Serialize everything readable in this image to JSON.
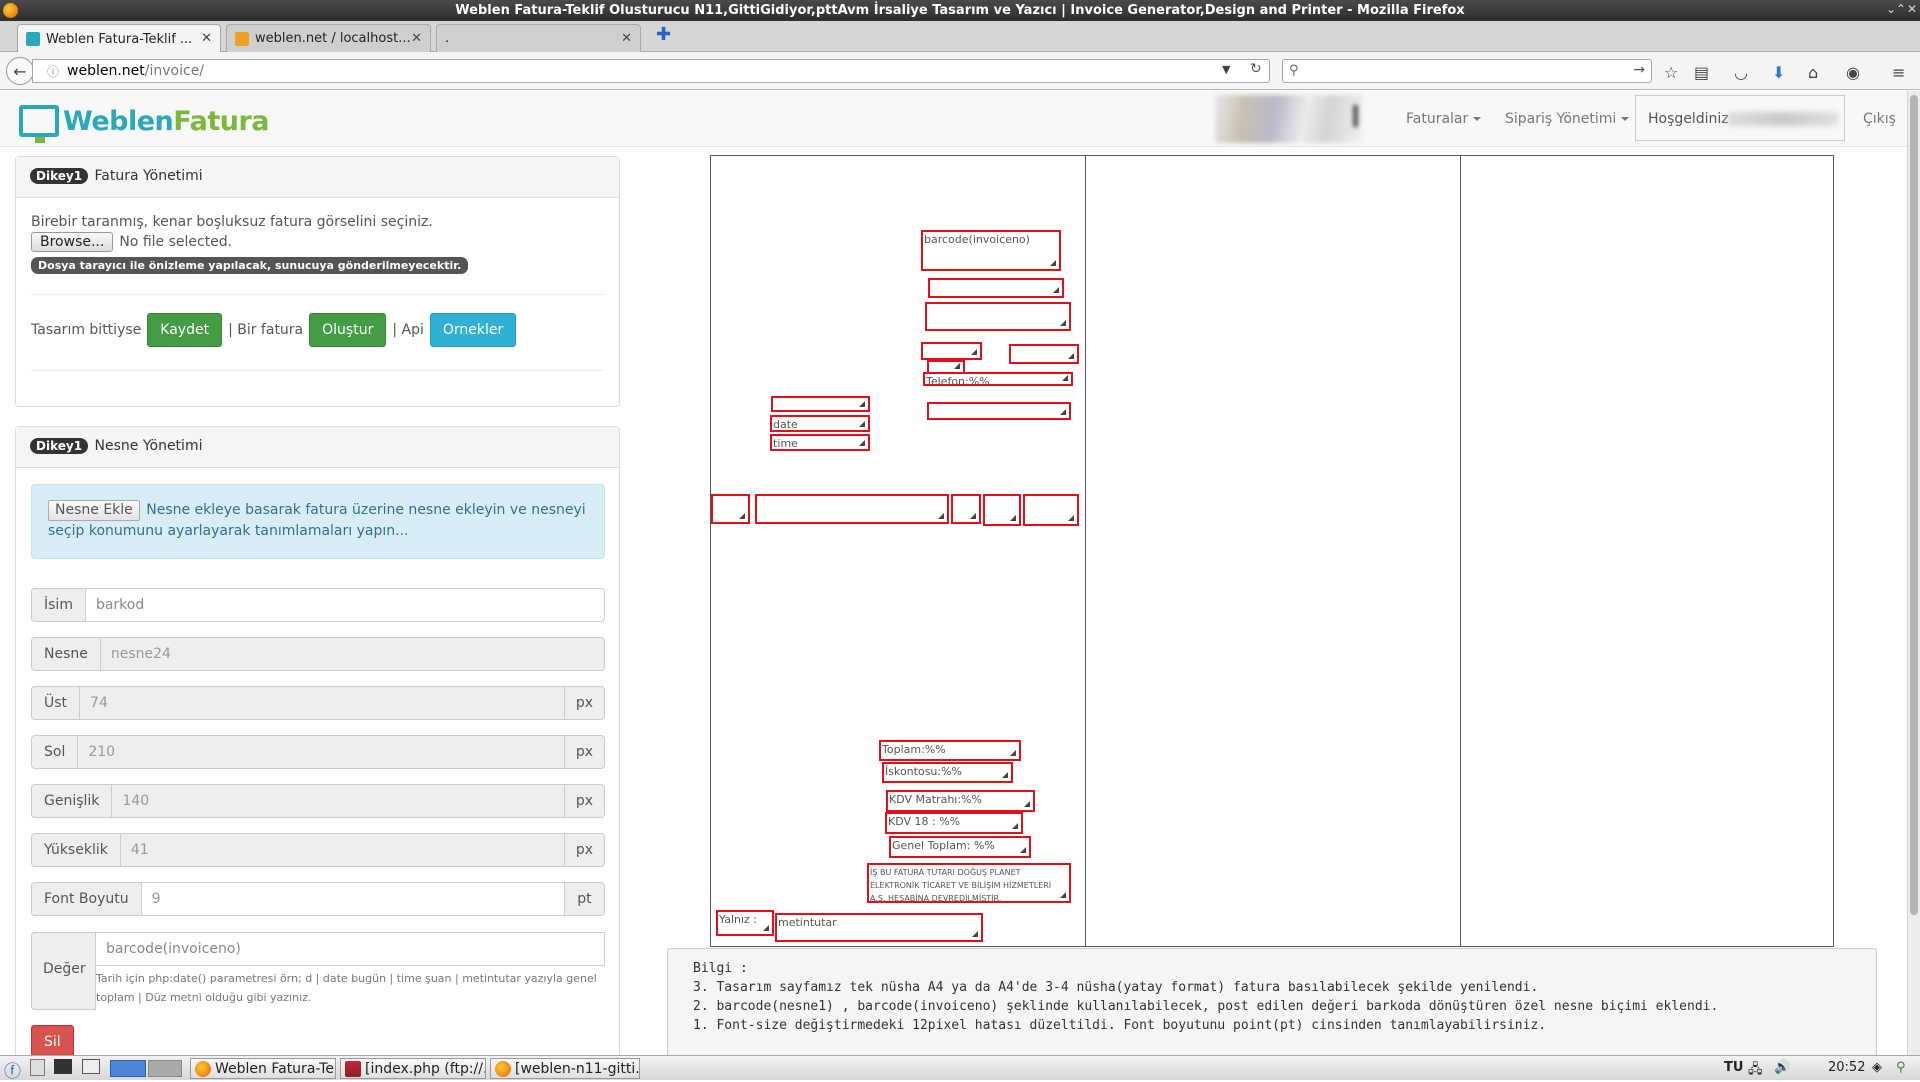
{
  "window": {
    "title": "Weblen Fatura-Teklif Olusturucu N11,GittiGidiyor,pttAvm İrsaliye Tasarım ve Yazıcı | Invoice Generator,Design and Printer - Mozilla Firefox",
    "controls": [
      "⌄",
      "⌃",
      "✕"
    ]
  },
  "tabs": [
    {
      "label": "Weblen Fatura-Teklif ...",
      "close": "✕"
    },
    {
      "label": "weblen.net / localhost...",
      "close": "✕"
    },
    {
      "label": ".",
      "close": "✕"
    }
  ],
  "newtab": "✚",
  "nav": {
    "url_host": "weblen.net",
    "url_path": "/invoice/",
    "search_placeholder": ""
  },
  "site": {
    "logo_part1": "Weblen",
    "logo_part2": "Fatura",
    "menu": {
      "faturalar": "Faturalar",
      "siparis": "Sipariş Yönetimi"
    },
    "welcome": "Hoşgeldiniz",
    "logout": "Çıkış"
  },
  "panel1": {
    "badge": "Dikey1",
    "title": "Fatura Yönetimi",
    "instruction": "Birebir taranmış, kenar boşluksuz fatura görselini seçiniz.",
    "browse": "Browse...",
    "no_file": "No file selected.",
    "notice": "Dosya tarayıcı ile önizleme yapılacak, sunucuya gönderilmeyecektir.",
    "prefix1": "Tasarım bittiyse",
    "save": "Kaydet",
    "prefix2": "| Bir fatura",
    "create": "Oluştur",
    "prefix3": "| Api",
    "examples": "Ornekler"
  },
  "panel2": {
    "badge": "Dikey1",
    "title": "Nesne Yönetimi",
    "add_button": "Nesne Ekle",
    "info": "Nesne ekleye basarak fatura üzerine nesne ekleyin ve nesneyi seçip konumunu ayarlayarak tanımlamaları yapın...",
    "fields": {
      "isim": {
        "label": "İsim",
        "value": "barkod"
      },
      "nesne": {
        "label": "Nesne",
        "value": "nesne24"
      },
      "ust": {
        "label": "Üst",
        "value": "74",
        "unit": "px"
      },
      "sol": {
        "label": "Sol",
        "value": "210",
        "unit": "px"
      },
      "genislik": {
        "label": "Genişlik",
        "value": "140",
        "unit": "px"
      },
      "yukseklik": {
        "label": "Yükseklik",
        "value": "41",
        "unit": "px"
      },
      "font": {
        "label": "Font Boyutu",
        "value": "9",
        "unit": "pt"
      }
    },
    "deger_label": "Değer",
    "deger_value": "barcode(invoiceno)",
    "deger_help": "Tarih için php:date() parametresi örn; d | date bugün | time şuan | metintutar yazıyla genel toplam | Düz metni olduğu gibi yazınız.",
    "delete": "Sil"
  },
  "design_objects": [
    {
      "id": "barcode",
      "text": "barcode(invoiceno)"
    },
    {
      "id": "o1",
      "text": ""
    },
    {
      "id": "o2",
      "text": ""
    },
    {
      "id": "o3",
      "text": ""
    },
    {
      "id": "o4",
      "text": ""
    },
    {
      "id": "o5",
      "text": ""
    },
    {
      "id": "telefon",
      "text": "Telefon:%%"
    },
    {
      "id": "o7",
      "text": ""
    },
    {
      "id": "o8",
      "text": ""
    },
    {
      "id": "date",
      "text": "date"
    },
    {
      "id": "time",
      "text": "time"
    },
    {
      "id": "r1",
      "text": ""
    },
    {
      "id": "r2",
      "text": ""
    },
    {
      "id": "r3",
      "text": ""
    },
    {
      "id": "r4",
      "text": ""
    },
    {
      "id": "r5",
      "text": ""
    },
    {
      "id": "toplam",
      "text": "Toplam:%%"
    },
    {
      "id": "iskonto",
      "text": "İskontosu:%%"
    },
    {
      "id": "kdvmatrah",
      "text": "KDV Matrahı:%%"
    },
    {
      "id": "kdv18",
      "text": "KDV 18 : %%"
    },
    {
      "id": "genel",
      "text": "Genel Toplam: %%"
    },
    {
      "id": "devir",
      "text": "İŞ BU FATURA TUTARI DOĞUŞ PLANET ELEKTRONİK TİCARET VE BİLİŞİM HİZMETLERİ A.Ş. HESABINA DEVREDİLMİŞTİR."
    },
    {
      "id": "yalniz",
      "text": "Yalnız :"
    },
    {
      "id": "metintutar",
      "text": "metintutar"
    }
  ],
  "bilgi": {
    "title": "Bilgi :",
    "lines": [
      "3. Tasarım sayfamız tek nüsha A4 ya da A4'de 3-4 nüsha(yatay format) fatura basılabilecek şekilde yenilendi.",
      "2. barcode(nesne1) , barcode(invoiceno) şeklinde kullanılabilecek, post edilen değeri barkoda dönüştüren özel nesne biçimi eklendi.",
      "1. Font-size değiştirmedeki 12pixel hatası düzeltildi. Font boyutunu point(pt) cinsinden tanımlayabilirsiniz."
    ]
  },
  "taskbar": {
    "items": [
      "Weblen Fatura-Te...",
      "[index.php (ftp://...",
      "[weblen-n11-gitti..."
    ],
    "lang": "TU",
    "clock": "20:52"
  }
}
